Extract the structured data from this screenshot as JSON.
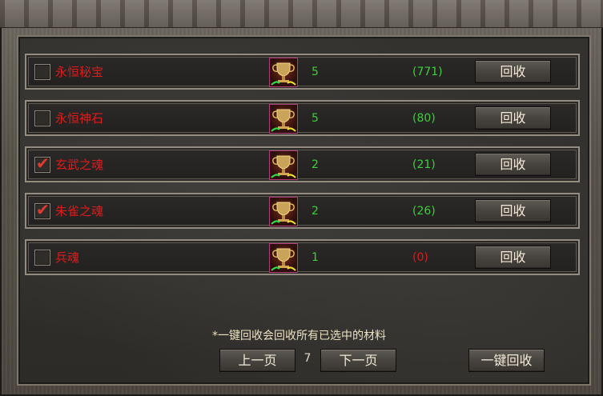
{
  "rows": [
    {
      "name": "永恒秘宝",
      "qty": "5",
      "owned": "(771)",
      "checked": false,
      "owned_color": "green",
      "button": "回收"
    },
    {
      "name": "永恒神石",
      "qty": "5",
      "owned": "(80)",
      "checked": false,
      "owned_color": "green",
      "button": "回收"
    },
    {
      "name": "玄武之魂",
      "qty": "2",
      "owned": "(21)",
      "checked": true,
      "owned_color": "green",
      "button": "回收"
    },
    {
      "name": "朱雀之魂",
      "qty": "2",
      "owned": "(26)",
      "checked": true,
      "owned_color": "green",
      "button": "回收"
    },
    {
      "name": "兵魂",
      "qty": "1",
      "owned": "(0)",
      "checked": false,
      "owned_color": "red",
      "button": "回收"
    }
  ],
  "check_symbol": "✔",
  "note": "*一键回收会回收所有已选中的材料",
  "pagination": {
    "prev": "上一页",
    "page": "7",
    "next": "下一页"
  },
  "recycle_all": "一键回收",
  "item_icon": "trophy-cup-icon",
  "colors": {
    "item_name": "#e01a1a",
    "value_green": "#3ad03a",
    "value_red": "#e01a1a",
    "check": "#e23a2e"
  }
}
